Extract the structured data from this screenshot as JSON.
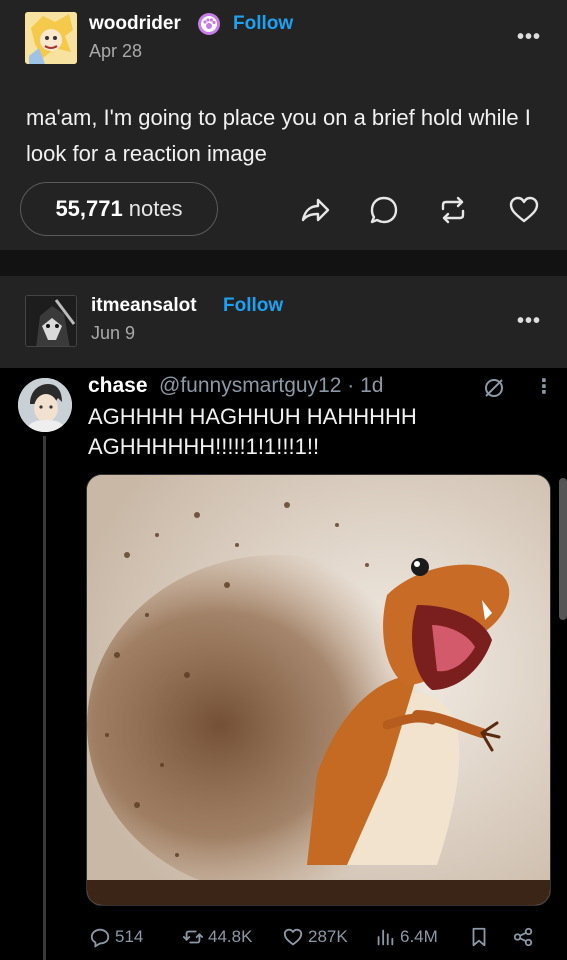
{
  "post1": {
    "username": "woodrider",
    "follow_label": "Follow",
    "date": "Apr 28",
    "text": "ma'am, I'm going to place you on a brief hold while I look for a reaction image",
    "notes_count": "55,771",
    "notes_label": "notes",
    "more_label": "•••"
  },
  "post2": {
    "username": "itmeansalot",
    "follow_label": "Follow",
    "date": "Jun 9",
    "more_label": "•••"
  },
  "tweet": {
    "name": "chase",
    "handle_time": "@funnysmartguy12 · 1d",
    "text": "AGHHHH HAGHHUH HAHHHHH AGHHHHHH!!!!!1!1!!!1!!",
    "replies": "514",
    "retweets": "44.8K",
    "likes": "287K",
    "views": "6.4M"
  },
  "colors": {
    "accent": "#1da1f2",
    "panel": "#232323",
    "muted": "#8b98a5"
  }
}
